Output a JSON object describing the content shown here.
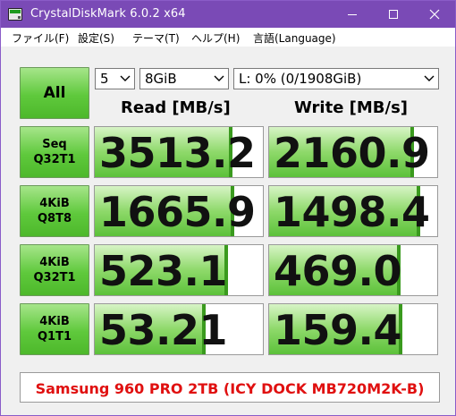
{
  "window": {
    "title": "CrystalDiskMark 6.0.2 x64",
    "title_bar_color": "#7a4ab6",
    "buttons": [
      "minimize",
      "maximize",
      "close"
    ]
  },
  "menu": [
    {
      "label": "ファイル(F)"
    },
    {
      "label": "設定(S)"
    },
    {
      "label": "テーマ(T)"
    },
    {
      "label": "ヘルプ(H)"
    },
    {
      "label": "言語(Language)"
    }
  ],
  "controls": {
    "all_label": "All",
    "test_count": "5",
    "test_size": "8GiB",
    "drive": "L: 0% (0/1908GiB)"
  },
  "headers": {
    "read": "Read [MB/s]",
    "write": "Write [MB/s]"
  },
  "tests": [
    {
      "line1": "Seq",
      "line2": "Q32T1",
      "read": "3513.2",
      "write": "2160.9",
      "read_fill": 0.82,
      "write_fill": 0.86
    },
    {
      "line1": "4KiB",
      "line2": "Q8T8",
      "read": "1665.9",
      "write": "1498.4",
      "read_fill": 0.83,
      "write_fill": 0.9
    },
    {
      "line1": "4KiB",
      "line2": "Q32T1",
      "read": "523.1",
      "write": "469.0",
      "read_fill": 0.79,
      "write_fill": 0.78
    },
    {
      "line1": "4KiB",
      "line2": "Q1T1",
      "read": "53.21",
      "write": "159.4",
      "read_fill": 0.66,
      "write_fill": 0.79
    }
  ],
  "comment": {
    "text": "Samsung 960 PRO 2TB (ICY DOCK MB720M2K-B)",
    "color": "#e01010"
  },
  "colors": {
    "accent_green": "#5fc93c",
    "bar_edge": "#3a9a1e"
  }
}
